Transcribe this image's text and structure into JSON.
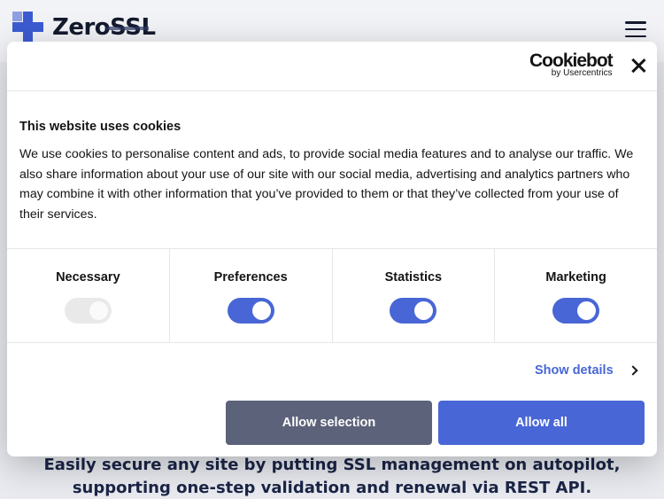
{
  "site": {
    "logo_text": "ZeroSSL",
    "hero_line1": "Easily secure any site by putting SSL management on autopilot,",
    "hero_line2": "supporting one-step validation and renewal via REST API."
  },
  "cookie_dialog": {
    "brand_name": "Cookiebot",
    "brand_sub": "by Usercentrics",
    "title": "This website uses cookies",
    "description": "We use cookies to personalise content and ads, to provide social media features and to analyse our traffic. We also share information about your use of our site with our social media, advertising and analytics partners who may combine it with other information that you’ve provided to them or that they’ve collected from your use of their services.",
    "categories": [
      {
        "label": "Necessary",
        "enabled": true,
        "locked": true
      },
      {
        "label": "Preferences",
        "enabled": true,
        "locked": false
      },
      {
        "label": "Statistics",
        "enabled": true,
        "locked": false
      },
      {
        "label": "Marketing",
        "enabled": true,
        "locked": false
      }
    ],
    "show_details_label": "Show details",
    "allow_selection_label": "Allow selection",
    "allow_all_label": "Allow all"
  },
  "colors": {
    "accent": "#4866d5",
    "secondary_button": "#5b6279",
    "logo": "#3c5bd2",
    "backdrop": "#e9ebf0"
  },
  "icons": {
    "menu": "hamburger-icon",
    "close": "close-icon",
    "details": "chevron-right-icon"
  }
}
